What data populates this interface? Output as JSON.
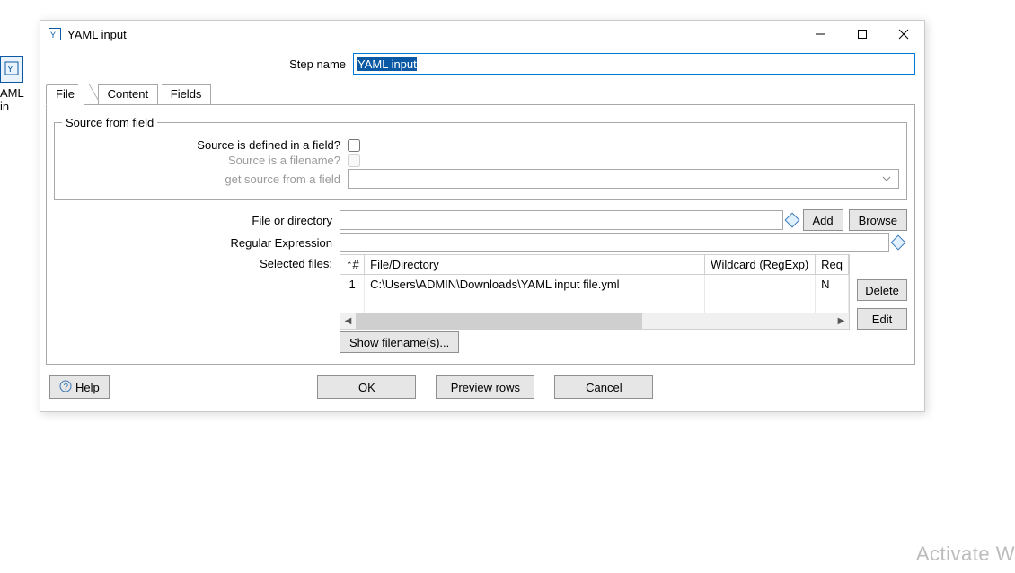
{
  "window": {
    "title": "YAML input"
  },
  "bgNodeLabel": "AML in",
  "stepName": {
    "label": "Step name",
    "value": "YAML input"
  },
  "tabs": {
    "file": "File",
    "content": "Content",
    "fields": "Fields"
  },
  "sourceGroup": {
    "legend": "Source from field",
    "definedInField": "Source is defined in a field?",
    "isFilename": "Source is a filename?",
    "getSourceFromField": "get source from a field"
  },
  "fileOrDirectory": {
    "label": "File or directory",
    "value": "",
    "addBtn": "Add",
    "browseBtn": "Browse"
  },
  "regex": {
    "label": "Regular Expression",
    "value": ""
  },
  "selectedFiles": {
    "label": "Selected files:",
    "cols": {
      "num": "#",
      "file": "File/Directory",
      "wildcard": "Wildcard (RegExp)",
      "req": "Req"
    },
    "rows": [
      {
        "n": "1",
        "file": "C:\\Users\\ADMIN\\Downloads\\YAML input file.yml",
        "wildcard": "",
        "req": "N"
      }
    ],
    "deleteBtn": "Delete",
    "editBtn": "Edit",
    "showFilenamesBtn": "Show filename(s)..."
  },
  "footer": {
    "help": "Help",
    "ok": "OK",
    "preview": "Preview rows",
    "cancel": "Cancel"
  },
  "watermark": "Activate W"
}
